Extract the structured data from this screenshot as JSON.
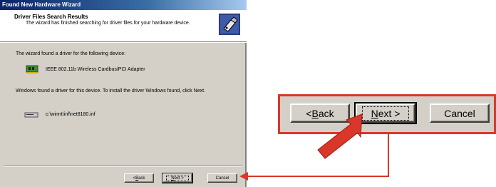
{
  "window": {
    "title": "Found New Hardware Wizard"
  },
  "header": {
    "title": "Driver Files Search Results",
    "subtitle": "The wizard has finished searching for driver files for your hardware device.",
    "icon": "wizard-hardware-icon"
  },
  "body": {
    "found_text": "The wizard found a driver for the following device:",
    "device_name": "IEEE 802.11b Wireless Cardbus/PCI Adapter",
    "device_icon": "network-card-icon",
    "install_text": "Windows found a driver for this device. To install the driver Windows found, click Next.",
    "driver_path": "c:\\winnt\\inf\\net8180.inf",
    "driver_icon": "disk-drive-icon"
  },
  "buttons": {
    "back_prefix": "< ",
    "back_accel": "B",
    "back_rest": "ack",
    "next_accel": "N",
    "next_rest": "ext >",
    "cancel": "Cancel"
  },
  "callout": {
    "accent_color": "#d9372a",
    "arrow_icon": "red-arrow-icon"
  }
}
